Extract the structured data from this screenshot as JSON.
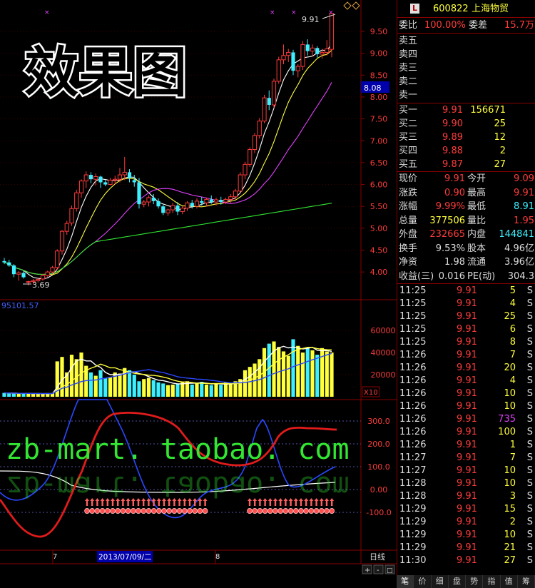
{
  "overlay": {
    "title": "效果图",
    "watermark": "zb-mart. taobao. com"
  },
  "stock": {
    "badge": "L",
    "code": "600822",
    "name": "上海物贸"
  },
  "commission": {
    "ratio_label": "委比",
    "ratio_value": "100.00%",
    "diff_label": "委差",
    "diff_value": "15.7万"
  },
  "asks": [
    {
      "label": "卖五",
      "price": "",
      "vol": ""
    },
    {
      "label": "卖四",
      "price": "",
      "vol": ""
    },
    {
      "label": "卖三",
      "price": "",
      "vol": ""
    },
    {
      "label": "卖二",
      "price": "",
      "vol": ""
    },
    {
      "label": "卖一",
      "price": "",
      "vol": ""
    }
  ],
  "bids": [
    {
      "label": "买一",
      "price": "9.91",
      "vol": "156671"
    },
    {
      "label": "买二",
      "price": "9.90",
      "vol": "25"
    },
    {
      "label": "买三",
      "price": "9.89",
      "vol": "12"
    },
    {
      "label": "买四",
      "price": "9.88",
      "vol": "2"
    },
    {
      "label": "买五",
      "price": "9.87",
      "vol": "27"
    }
  ],
  "quote": [
    {
      "l1": "现价",
      "v1": "9.91",
      "l2": "今开",
      "v2": "9.09"
    },
    {
      "l1": "涨跌",
      "v1": "0.90",
      "l2": "最高",
      "v2": "9.91"
    },
    {
      "l1": "涨幅",
      "v1": "9.99%",
      "l2": "最低",
      "v2": "8.91"
    },
    {
      "l1": "总量",
      "v1": "377506",
      "l2": "量比",
      "v2": "1.95"
    },
    {
      "l1": "外盘",
      "v1": "232665",
      "l2": "内盘",
      "v2": "144841"
    },
    {
      "l1": "换手",
      "v1": "9.53%",
      "l2": "股本",
      "v2": "4.96亿"
    },
    {
      "l1": "净资",
      "v1": "1.98",
      "l2": "流通",
      "v2": "3.96亿"
    },
    {
      "l1": "收益(三)",
      "v1": "0.016",
      "l2": "PE(动)",
      "v2": "304.3"
    }
  ],
  "ticks": [
    {
      "time": "11:25",
      "price": "9.91",
      "vol": "5",
      "side": "S"
    },
    {
      "time": "11:25",
      "price": "9.91",
      "vol": "4",
      "side": "S"
    },
    {
      "time": "11:25",
      "price": "9.91",
      "vol": "25",
      "side": "S"
    },
    {
      "time": "11:25",
      "price": "9.91",
      "vol": "6",
      "side": "S"
    },
    {
      "time": "11:25",
      "price": "9.91",
      "vol": "8",
      "side": "S"
    },
    {
      "time": "11:26",
      "price": "9.91",
      "vol": "7",
      "side": "S"
    },
    {
      "time": "11:26",
      "price": "9.91",
      "vol": "20",
      "side": "S"
    },
    {
      "time": "11:26",
      "price": "9.91",
      "vol": "4",
      "side": "S"
    },
    {
      "time": "11:26",
      "price": "9.91",
      "vol": "10",
      "side": "S"
    },
    {
      "time": "11:26",
      "price": "9.91",
      "vol": "10",
      "side": "S"
    },
    {
      "time": "11:26",
      "price": "9.91",
      "vol": "735",
      "side": "S"
    },
    {
      "time": "11:26",
      "price": "9.91",
      "vol": "100",
      "side": "S"
    },
    {
      "time": "11:26",
      "price": "9.91",
      "vol": "1",
      "side": "S"
    },
    {
      "time": "11:27",
      "price": "9.91",
      "vol": "7",
      "side": "S"
    },
    {
      "time": "11:27",
      "price": "9.91",
      "vol": "10",
      "side": "S"
    },
    {
      "time": "11:28",
      "price": "9.91",
      "vol": "10",
      "side": "S"
    },
    {
      "time": "11:28",
      "price": "9.91",
      "vol": "3",
      "side": "S"
    },
    {
      "time": "11:29",
      "price": "9.91",
      "vol": "15",
      "side": "S"
    },
    {
      "time": "11:29",
      "price": "9.91",
      "vol": "2",
      "side": "S"
    },
    {
      "time": "11:29",
      "price": "9.91",
      "vol": "10",
      "side": "S"
    },
    {
      "time": "11:29",
      "price": "9.91",
      "vol": "21",
      "side": "S"
    },
    {
      "time": "11:30",
      "price": "9.91",
      "vol": "27",
      "side": "S"
    }
  ],
  "tabs": [
    "笔",
    "价",
    "细",
    "盘",
    "势",
    "指",
    "值",
    "筹"
  ],
  "chart_data": [
    {
      "type": "candlestick",
      "yticks": [
        "9.50",
        "9.00",
        "8.50",
        "8.00",
        "7.50",
        "7.00",
        "6.50",
        "6.00",
        "5.50",
        "5.00",
        "4.50",
        "4.00"
      ],
      "crosshair_label": "8.08",
      "high_label": "9.91",
      "low_label": "3.69",
      "candles": [
        [
          4.25,
          4.32,
          4.18,
          4.22
        ],
        [
          4.22,
          4.28,
          4.12,
          4.15
        ],
        [
          4.15,
          4.18,
          3.88,
          3.95
        ],
        [
          3.95,
          4.02,
          3.8,
          3.98
        ],
        [
          3.98,
          4.03,
          3.85,
          3.88
        ],
        [
          3.78,
          3.8,
          3.69,
          3.78
        ],
        [
          3.78,
          3.84,
          3.72,
          3.8
        ],
        [
          3.8,
          3.86,
          3.76,
          3.83
        ],
        [
          3.84,
          3.96,
          3.8,
          3.92
        ],
        [
          3.92,
          4.03,
          3.88,
          4.0
        ],
        [
          4.0,
          4.14,
          3.95,
          4.1
        ],
        [
          4.1,
          4.52,
          4.05,
          4.48
        ],
        [
          4.48,
          4.96,
          4.4,
          4.93
        ],
        [
          4.93,
          5.17,
          4.85,
          5.11
        ],
        [
          5.12,
          5.52,
          5.05,
          5.45
        ],
        [
          5.45,
          5.88,
          5.38,
          5.81
        ],
        [
          5.81,
          6.12,
          5.7,
          6.08
        ],
        [
          6.08,
          6.3,
          5.92,
          6.22
        ],
        [
          6.22,
          6.28,
          6.03,
          6.12
        ],
        [
          6.12,
          6.25,
          5.98,
          6.18
        ],
        [
          6.18,
          6.2,
          5.92,
          6.05
        ],
        [
          6.05,
          6.1,
          5.96,
          6.0
        ],
        [
          6.0,
          6.15,
          5.98,
          6.1
        ],
        [
          6.1,
          6.2,
          6.0,
          6.12
        ],
        [
          6.12,
          6.38,
          6.05,
          6.22
        ],
        [
          6.22,
          6.63,
          6.1,
          6.28
        ],
        [
          6.28,
          6.35,
          6.05,
          6.15
        ],
        [
          6.1,
          6.22,
          5.95,
          6.05
        ],
        [
          6.05,
          6.15,
          5.45,
          5.55
        ],
        [
          5.55,
          5.65,
          5.48,
          5.6
        ],
        [
          5.6,
          5.75,
          5.5,
          5.7
        ],
        [
          5.7,
          5.78,
          5.55,
          5.62
        ],
        [
          5.62,
          5.68,
          5.45,
          5.5
        ],
        [
          5.5,
          5.55,
          5.3,
          5.35
        ],
        [
          5.35,
          5.45,
          5.28,
          5.42
        ],
        [
          5.42,
          5.58,
          5.35,
          5.52
        ],
        [
          5.52,
          5.6,
          5.3,
          5.38
        ],
        [
          5.38,
          5.5,
          5.32,
          5.46
        ],
        [
          5.46,
          5.62,
          5.4,
          5.58
        ],
        [
          5.58,
          5.65,
          5.45,
          5.5
        ],
        [
          5.5,
          5.68,
          5.45,
          5.62
        ],
        [
          5.62,
          5.72,
          5.52,
          5.58
        ],
        [
          5.58,
          5.7,
          5.5,
          5.66
        ],
        [
          5.66,
          5.75,
          5.56,
          5.6
        ],
        [
          5.6,
          5.7,
          5.52,
          5.65
        ],
        [
          5.65,
          5.72,
          5.54,
          5.6
        ],
        [
          5.6,
          5.7,
          5.55,
          5.66
        ],
        [
          5.66,
          5.78,
          5.58,
          5.72
        ],
        [
          5.72,
          5.9,
          5.65,
          5.85
        ],
        [
          5.85,
          6.28,
          5.8,
          6.22
        ],
        [
          6.22,
          6.52,
          6.12,
          6.46
        ],
        [
          6.46,
          6.85,
          6.4,
          6.8
        ],
        [
          6.8,
          7.18,
          6.72,
          7.12
        ],
        [
          7.12,
          7.52,
          7.05,
          7.45
        ],
        [
          7.45,
          8.05,
          7.4,
          7.98
        ],
        [
          7.98,
          8.15,
          7.7,
          7.82
        ],
        [
          7.82,
          8.42,
          7.75,
          8.36
        ],
        [
          8.36,
          8.92,
          8.3,
          8.85
        ],
        [
          8.85,
          9.2,
          8.75,
          8.95
        ],
        [
          8.95,
          9.1,
          8.8,
          9.02
        ],
        [
          9.02,
          9.08,
          8.5,
          8.6
        ],
        [
          8.6,
          8.75,
          8.45,
          8.7
        ],
        [
          8.7,
          9.28,
          8.62,
          9.2
        ],
        [
          9.2,
          9.32,
          8.95,
          9.05
        ],
        [
          9.05,
          9.2,
          8.92,
          9.12
        ],
        [
          9.12,
          9.16,
          8.9,
          8.98
        ],
        [
          8.98,
          9.1,
          8.88,
          9.02
        ],
        [
          9.02,
          9.3,
          8.95,
          9.1
        ],
        [
          9.09,
          9.91,
          8.91,
          9.91
        ]
      ]
    },
    {
      "type": "bar",
      "header": "95101.57",
      "yticks": [
        "60000",
        "40000",
        "20000"
      ],
      "unit_label": "X10",
      "values": [
        3500,
        3200,
        3000,
        2800,
        3100,
        2600,
        2400,
        2500,
        2700,
        3000,
        3200,
        32000,
        36000,
        22000,
        38000,
        34000,
        40000,
        28000,
        22000,
        19000,
        24000,
        17000,
        18000,
        22000,
        21000,
        26000,
        24000,
        20000,
        14000,
        16000,
        17000,
        15000,
        13000,
        12000,
        10500,
        11000,
        12000,
        13000,
        14000,
        11000,
        12000,
        13500,
        11000,
        10500,
        12000,
        10800,
        13000,
        11500,
        14000,
        16000,
        24000,
        27000,
        30000,
        34000,
        44000,
        48000,
        50000,
        45000,
        41000,
        37000,
        52000,
        46000,
        40000,
        44000,
        42000,
        38000,
        44000,
        41000,
        40000
      ]
    },
    {
      "type": "line",
      "yticks": [
        "300.0",
        "200.0",
        "100.0",
        "0.00",
        "-100.0"
      ]
    }
  ],
  "date_labels": [
    "7",
    "2013/07/09/二",
    "8"
  ],
  "period_label": "日线",
  "zoom_buttons": [
    "+",
    "-",
    "□"
  ]
}
